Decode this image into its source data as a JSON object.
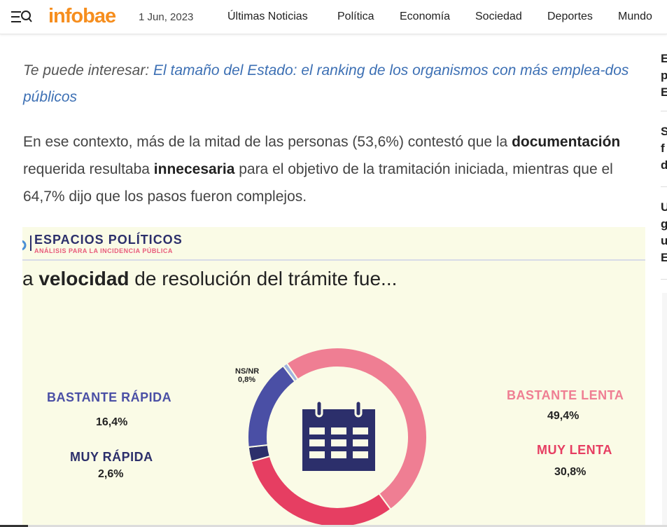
{
  "header": {
    "logo": "infobae",
    "date": "1 Jun, 2023",
    "nav": [
      "Últimas Noticias",
      "Política",
      "Economía",
      "Sociedad",
      "Deportes",
      "Mundo"
    ]
  },
  "sidebar": {
    "items": [
      "E\np\nE",
      "S\nf\nd",
      "U\ng\nu\nE"
    ]
  },
  "article": {
    "interest_prefix": "Te puede interesar:",
    "interest_link": "El tamaño del Estado: el ranking de los organismos con más emplea-dos públicos",
    "para_1": "En ese contexto, más de la mitad de las personas (53,6%) contestó que la",
    "para_bold_1": "documentación",
    "para_2": " requerida resultaba ",
    "para_bold_2": "innecesaria",
    "para_3": " para el objetivo de la tramitación iniciada, mientras que el 64,7% dijo que los pasos fueron complejos."
  },
  "infographic": {
    "brand_title": "ESPACIOS POLÍTICOS",
    "brand_sub": "ANÁLISIS PARA LA INCIDENCIA PÚBLICA",
    "headline_pre": "a ",
    "headline_bold": "velocidad",
    "headline_post": " de resolución del trámite fue...",
    "icon": "calendar-icon",
    "colors": {
      "bastante_rapida": "#4a4fa5",
      "muy_rapida": "#2c2f6b",
      "bastante_lenta": "#ef7e93",
      "muy_lenta": "#e63e62",
      "nsnr": "#9fb3e0"
    }
  },
  "chart_data": {
    "type": "pie",
    "categories": [
      "Bastante lenta",
      "Muy lenta",
      "Muy rápida",
      "Bastante rápida",
      "NS/NR"
    ],
    "values": [
      49.4,
      30.8,
      2.6,
      16.4,
      0.8
    ],
    "labels": {
      "bastante_rapida": "BASTANTE RÁPIDA",
      "bastante_rapida_val": "16,4%",
      "muy_rapida": "MUY RÁPIDA",
      "muy_rapida_val": "2,6%",
      "bastante_lenta": "BASTANTE LENTA",
      "bastante_lenta_val": "49,4%",
      "muy_lenta": "MUY LENTA",
      "muy_lenta_val": "30,8%",
      "nsnr": "NS/NR",
      "nsnr_val": "0,8%"
    }
  }
}
